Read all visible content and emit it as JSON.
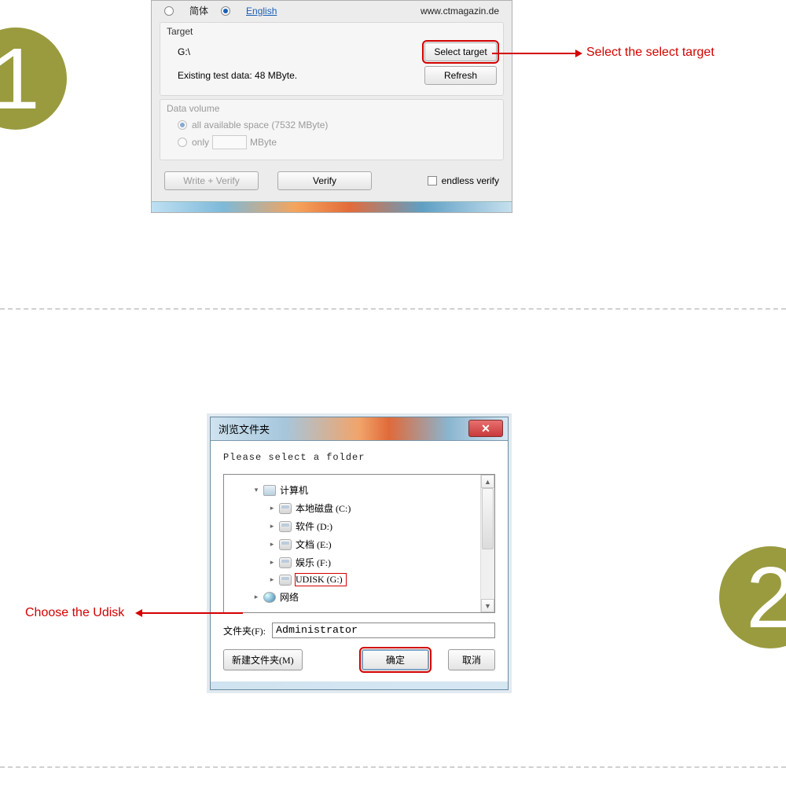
{
  "steps": {
    "one": "1",
    "two": "2"
  },
  "annotations": {
    "select_target": "Select the select target",
    "choose_udisk": "Choose the Udisk"
  },
  "win1": {
    "lang": {
      "simplified": "简体",
      "english": "English"
    },
    "url": "www.ctmagazin.de",
    "target_group": "Target",
    "target_path": "G:\\",
    "select_target_btn": "Select target",
    "existing": "Existing test data: 48 MByte.",
    "refresh_btn": "Refresh",
    "data_volume_group": "Data volume",
    "all_space": "all available space (7532 MByte)",
    "only_label": "only",
    "mbyte_suffix": "MByte",
    "write_verify_btn": "Write + Verify",
    "verify_btn": "Verify",
    "endless_verify": "endless verify"
  },
  "win2": {
    "title": "浏览文件夹",
    "instruction": "Please select a folder",
    "tree": {
      "computer": "计算机",
      "local_c": "本地磁盘 (C:)",
      "soft_d": "软件 (D:)",
      "doc_e": "文档 (E:)",
      "ent_f": "娱乐 (F:)",
      "udisk_g": "UDISK (G:)",
      "network": "网络"
    },
    "folder_label": "文件夹(F):",
    "folder_value": "Administrator",
    "new_folder_btn": "新建文件夹(M)",
    "ok_btn": "确定",
    "cancel_btn": "取消"
  }
}
